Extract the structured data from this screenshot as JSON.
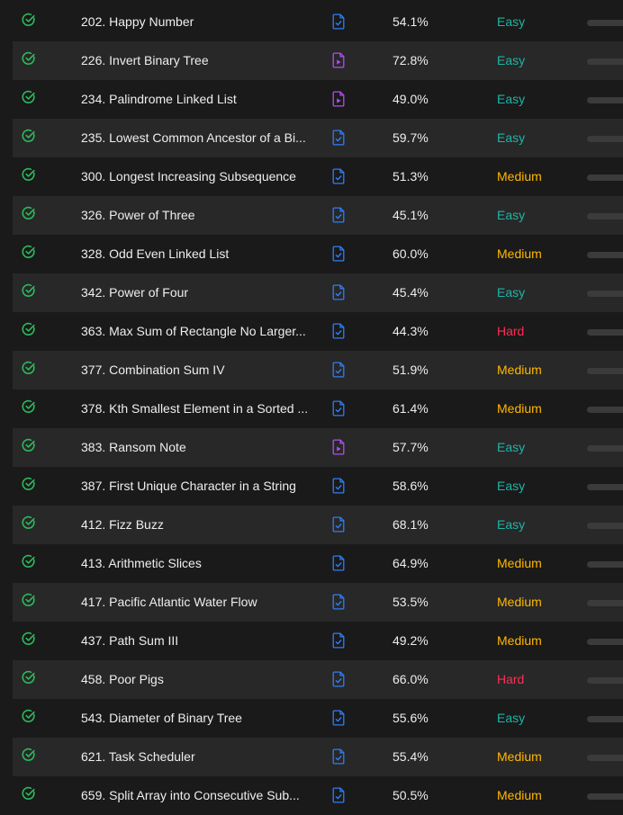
{
  "colors": {
    "solved": "#2cbb5d",
    "solution_article": "#2f7df6",
    "solution_video": "#b04df0",
    "easy": "#1db6a6",
    "medium": "#ffb800",
    "hard": "#ff2d55"
  },
  "problems": [
    {
      "status": "solved",
      "title": "202. Happy Number",
      "solution": "article",
      "acceptance": "54.1%",
      "difficulty": "Easy"
    },
    {
      "status": "solved",
      "title": "226. Invert Binary Tree",
      "solution": "video",
      "acceptance": "72.8%",
      "difficulty": "Easy"
    },
    {
      "status": "solved",
      "title": "234. Palindrome Linked List",
      "solution": "video",
      "acceptance": "49.0%",
      "difficulty": "Easy"
    },
    {
      "status": "solved",
      "title": "235. Lowest Common Ancestor of a Bi...",
      "solution": "article",
      "acceptance": "59.7%",
      "difficulty": "Easy"
    },
    {
      "status": "solved",
      "title": "300. Longest Increasing Subsequence",
      "solution": "article",
      "acceptance": "51.3%",
      "difficulty": "Medium"
    },
    {
      "status": "solved",
      "title": "326. Power of Three",
      "solution": "article",
      "acceptance": "45.1%",
      "difficulty": "Easy"
    },
    {
      "status": "solved",
      "title": "328. Odd Even Linked List",
      "solution": "article",
      "acceptance": "60.0%",
      "difficulty": "Medium"
    },
    {
      "status": "solved",
      "title": "342. Power of Four",
      "solution": "article",
      "acceptance": "45.4%",
      "difficulty": "Easy"
    },
    {
      "status": "solved",
      "title": "363. Max Sum of Rectangle No Larger...",
      "solution": "article",
      "acceptance": "44.3%",
      "difficulty": "Hard"
    },
    {
      "status": "solved",
      "title": "377. Combination Sum IV",
      "solution": "article",
      "acceptance": "51.9%",
      "difficulty": "Medium"
    },
    {
      "status": "solved",
      "title": "378. Kth Smallest Element in a Sorted ...",
      "solution": "article",
      "acceptance": "61.4%",
      "difficulty": "Medium"
    },
    {
      "status": "solved",
      "title": "383. Ransom Note",
      "solution": "video",
      "acceptance": "57.7%",
      "difficulty": "Easy"
    },
    {
      "status": "solved",
      "title": "387. First Unique Character in a String",
      "solution": "article",
      "acceptance": "58.6%",
      "difficulty": "Easy"
    },
    {
      "status": "solved",
      "title": "412. Fizz Buzz",
      "solution": "article",
      "acceptance": "68.1%",
      "difficulty": "Easy"
    },
    {
      "status": "solved",
      "title": "413. Arithmetic Slices",
      "solution": "article",
      "acceptance": "64.9%",
      "difficulty": "Medium"
    },
    {
      "status": "solved",
      "title": "417. Pacific Atlantic Water Flow",
      "solution": "article",
      "acceptance": "53.5%",
      "difficulty": "Medium"
    },
    {
      "status": "solved",
      "title": "437. Path Sum III",
      "solution": "article",
      "acceptance": "49.2%",
      "difficulty": "Medium"
    },
    {
      "status": "solved",
      "title": "458. Poor Pigs",
      "solution": "article",
      "acceptance": "66.0%",
      "difficulty": "Hard"
    },
    {
      "status": "solved",
      "title": "543. Diameter of Binary Tree",
      "solution": "article",
      "acceptance": "55.6%",
      "difficulty": "Easy"
    },
    {
      "status": "solved",
      "title": "621. Task Scheduler",
      "solution": "article",
      "acceptance": "55.4%",
      "difficulty": "Medium"
    },
    {
      "status": "solved",
      "title": "659. Split Array into Consecutive Sub...",
      "solution": "article",
      "acceptance": "50.5%",
      "difficulty": "Medium"
    }
  ]
}
